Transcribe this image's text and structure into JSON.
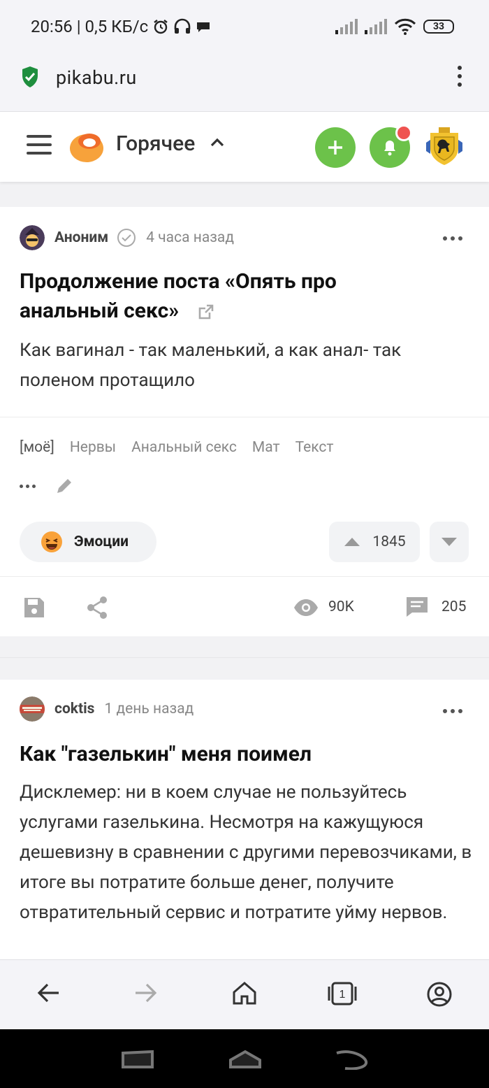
{
  "status_bar": {
    "left_text": "20:56 | 0,5 КБ/с",
    "battery": "33"
  },
  "browser": {
    "url": "pikabu.ru"
  },
  "header": {
    "section": "Горячее"
  },
  "posts": [
    {
      "author": "Аноним",
      "time": "4 часа назад",
      "title": "Продолжение поста «Опять про анальный секс»",
      "body": "Как вагинал - так маленький, а как анал- так поленом протащило",
      "tags": [
        "[моё]",
        "Нервы",
        "Анальный секс",
        "Мат",
        "Текст"
      ],
      "emotions_label": "Эмоции",
      "rating": "1845",
      "views": "90K",
      "comments": "205"
    },
    {
      "author": "coktis",
      "time": "1 день назад",
      "title": "Как \"газелькин\" меня поимел",
      "body": "Дисклемер: ни в коем случае не пользуйтесь услугами газелькина. Несмотря на кажущуюся дешевизну в сравнении с другими перевозчиками, в итоге вы потратите больше денег, получите отвратительный сервис и потратите уйму нервов."
    }
  ],
  "colors": {
    "accent_green": "#6cc24a",
    "notification_red": "#ef5350"
  }
}
